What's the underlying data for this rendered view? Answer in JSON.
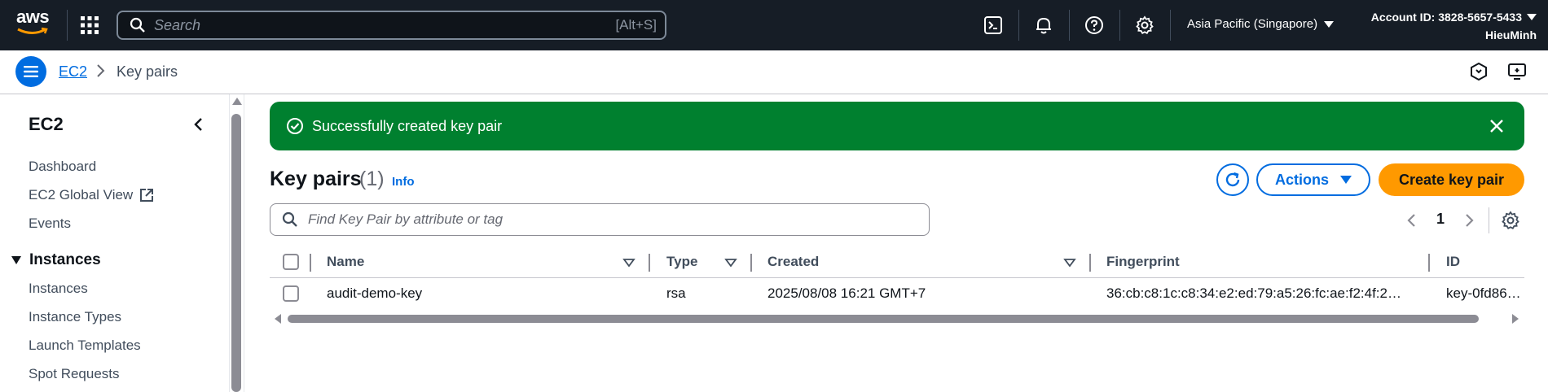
{
  "topnav": {
    "logo_text": "aws",
    "search_placeholder": "Search",
    "search_shortcut": "[Alt+S]",
    "region": "Asia Pacific (Singapore)",
    "account": "Account ID: 3828-5657-5433",
    "user": "HieuMinh",
    "icons": [
      "cloudshell-icon",
      "bell-icon",
      "help-icon",
      "gear-icon"
    ]
  },
  "breadcrumb": {
    "link": "EC2",
    "current": "Key pairs"
  },
  "sidebar": {
    "title": "EC2",
    "items": [
      {
        "label": "Dashboard"
      },
      {
        "label": "EC2 Global View"
      },
      {
        "label": "Events"
      }
    ],
    "section": "Instances",
    "section_items": [
      {
        "label": "Instances"
      },
      {
        "label": "Instance Types"
      },
      {
        "label": "Launch Templates"
      },
      {
        "label": "Spot Requests"
      }
    ]
  },
  "flash": {
    "message": "Successfully created key pair"
  },
  "header": {
    "title": "Key pairs",
    "count": "(1)",
    "info": "Info",
    "actions_label": "Actions",
    "create_label": "Create key pair"
  },
  "filter": {
    "placeholder": "Find Key Pair by attribute or tag"
  },
  "pagination": {
    "page": "1"
  },
  "table": {
    "columns": [
      "Name",
      "Type",
      "Created",
      "Fingerprint",
      "ID"
    ],
    "rows": [
      {
        "name": "audit-demo-key",
        "type": "rsa",
        "created": "2025/08/08 16:21 GMT+7",
        "fingerprint": "36:cb:c8:1c:c8:34:e2:ed:79:a5:26:fc:ae:f2:4f:2…",
        "id": "key-0fd86…"
      }
    ]
  },
  "colors": {
    "nav_bg": "#161d26",
    "accent": "#006ce0",
    "success": "#00802f",
    "primary_button": "#ff9900"
  }
}
